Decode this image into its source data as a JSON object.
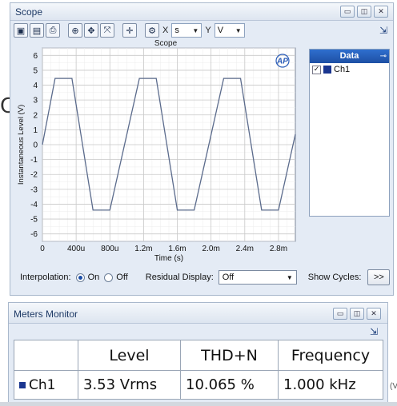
{
  "background_text": {
    "stray_letter": "C",
    "right_edge": "(V"
  },
  "scope": {
    "title": "Scope",
    "window_controls": [
      "▭",
      "◫",
      "✕"
    ],
    "toolbar": {
      "x_label": "X",
      "x_unit": "s",
      "y_label": "Y",
      "y_unit": "V"
    },
    "data_panel": {
      "header": "Data",
      "pin": "⊸",
      "items": [
        {
          "label": "Ch1",
          "checked": "✓",
          "color": "#1a3690"
        }
      ]
    },
    "bottom": {
      "interpolation_label": "Interpolation:",
      "on_label": "On",
      "off_label": "Off",
      "residual_label": "Residual Display:",
      "residual_value": "Off",
      "cycles_label": "Show Cycles:",
      "cycles_button": ">>"
    }
  },
  "chart_data": {
    "type": "line",
    "title": "Scope",
    "xlabel": "Time (s)",
    "ylabel": "Instantaneous Level (V)",
    "xlim": [
      0,
      0.003
    ],
    "ylim": [
      -6.5,
      6.5
    ],
    "grid": true,
    "logo": "AP",
    "x_ticks": [
      {
        "v": 0,
        "label": "0"
      },
      {
        "v": 0.0004,
        "label": "400u"
      },
      {
        "v": 0.0008,
        "label": "800u"
      },
      {
        "v": 0.0012,
        "label": "1.2m"
      },
      {
        "v": 0.0016,
        "label": "1.6m"
      },
      {
        "v": 0.002,
        "label": "2.0m"
      },
      {
        "v": 0.0024,
        "label": "2.4m"
      },
      {
        "v": 0.0028,
        "label": "2.8m"
      }
    ],
    "y_ticks": [
      {
        "v": 6,
        "label": "6"
      },
      {
        "v": 5,
        "label": "5"
      },
      {
        "v": 4,
        "label": "4"
      },
      {
        "v": 3,
        "label": "3"
      },
      {
        "v": 2,
        "label": "2"
      },
      {
        "v": 1,
        "label": "1"
      },
      {
        "v": 0,
        "label": "0"
      },
      {
        "v": -1,
        "label": "-1"
      },
      {
        "v": -2,
        "label": "-2"
      },
      {
        "v": -3,
        "label": "-3"
      },
      {
        "v": -4,
        "label": "-4"
      },
      {
        "v": -5,
        "label": "-5"
      },
      {
        "v": -6,
        "label": "-6"
      }
    ],
    "series": [
      {
        "color": "#5b6b8c",
        "x": [
          0,
          0.00015,
          0.00035,
          0.0006,
          0.0008,
          0.00115,
          0.00135,
          0.0016,
          0.0018,
          0.00215,
          0.00235,
          0.0026,
          0.0028,
          0.003
        ],
        "y": [
          0,
          4.45,
          4.45,
          -4.4,
          -4.4,
          4.45,
          4.45,
          -4.4,
          -4.4,
          4.45,
          4.45,
          -4.4,
          -4.4,
          0.7
        ]
      }
    ]
  },
  "meters": {
    "title": "Meters Monitor",
    "window_controls": [
      "▭",
      "◫",
      "✕"
    ],
    "columns": [
      "",
      "Level",
      "THD+N",
      "Frequency"
    ],
    "rows": [
      {
        "channel": "Ch1",
        "level": "3.53 Vrms",
        "thd": "10.065 %",
        "frequency": "1.000 kHz",
        "color": "#1a3690"
      }
    ]
  }
}
